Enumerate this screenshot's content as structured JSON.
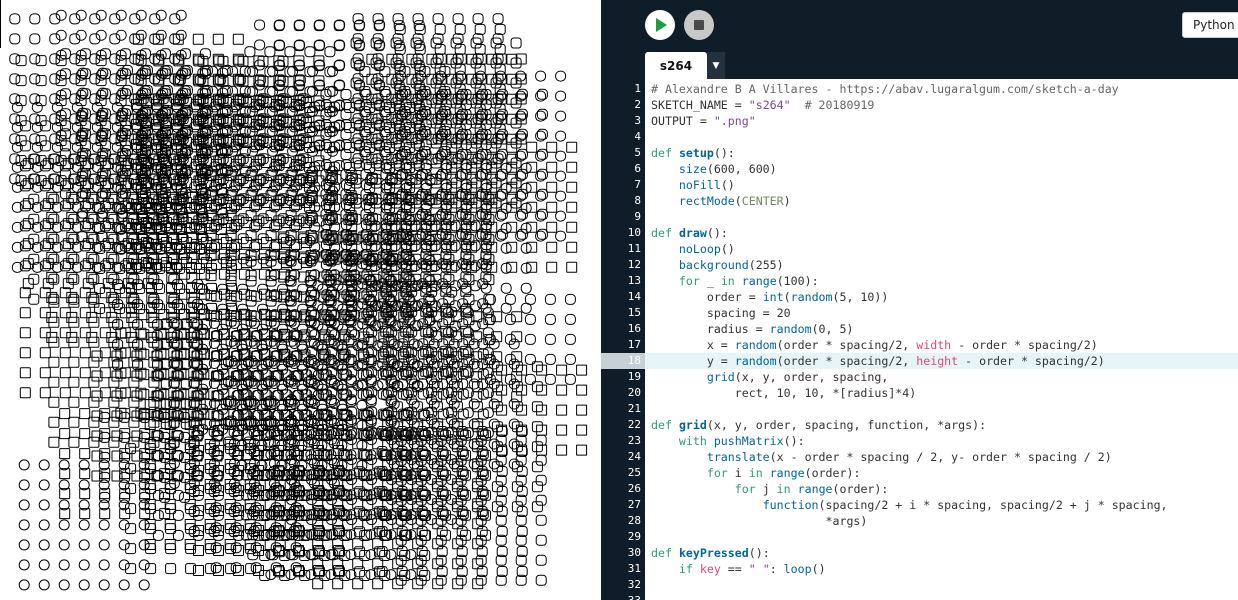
{
  "toolbar": {
    "mode_label": "Python",
    "run_label": "Run",
    "stop_label": "Stop"
  },
  "tabs": [
    {
      "label": "s264",
      "selected": true
    }
  ],
  "editor": {
    "active_line": 18,
    "code_lines": [
      "# Alexandre B A Villares - https://abav.lugaralgum.com/sketch-a-day",
      "SKETCH_NAME = \"s264\"  # 20180919",
      "OUTPUT = \".png\"",
      "",
      "def setup():",
      "    size(600, 600)",
      "    noFill()",
      "    rectMode(CENTER)",
      "",
      "def draw():",
      "    noLoop()",
      "    background(255)",
      "    for _ in range(100):",
      "        order = int(random(5, 10))",
      "        spacing = 20",
      "        radius = random(0, 5)",
      "        x = random(order * spacing/2, width - order * spacing/2)",
      "        y = random(order * spacing/2, height - order * spacing/2)",
      "        grid(x, y, order, spacing,",
      "            rect, 10, 10, *[radius]*4)",
      "",
      "def grid(x, y, order, spacing, function, *args):",
      "    with pushMatrix():",
      "        translate(x - order * spacing / 2, y- order * spacing / 2)",
      "        for i in range(order):",
      "            for j in range(order):",
      "                function(spacing/2 + i * spacing, spacing/2 + j * spacing,",
      "                         *args)",
      "",
      "def keyPressed():",
      "    if key == \" \": loop()",
      "",
      ""
    ]
  },
  "colors": {
    "ide_background": "#0f1d28",
    "run_icon": "#1e9c3e",
    "active_line": "#e6f4f8"
  },
  "icons": {
    "run": "play-icon",
    "stop": "stop-icon",
    "tab_menu": "caret-down-icon"
  }
}
